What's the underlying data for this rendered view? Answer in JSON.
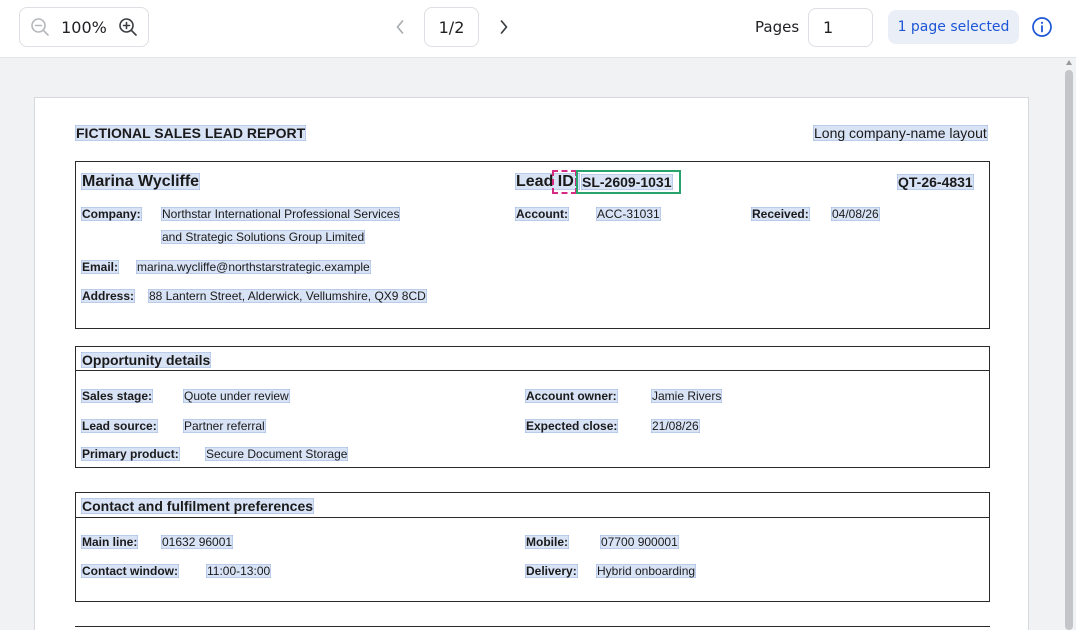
{
  "toolbar": {
    "zoom_level": "100%",
    "zoom_out_icon": "zoom-out-icon",
    "zoom_in_icon": "zoom-in-icon",
    "page_indicator": "1/2",
    "pages_label": "Pages",
    "pages_input_value": "1",
    "selection_label": "1 page selected",
    "accent_color": "#1d56d6"
  },
  "report": {
    "title": "FICTIONAL SALES LEAD REPORT",
    "layout_note": "Long company-name layout",
    "lead": {
      "name": "Marina Wycliffe",
      "lead_id_label": "Lead ID:",
      "lead_id": "SL-2609-1031",
      "quote_id": "QT-26-4831",
      "company_label": "Company:",
      "company_line1": "Northstar International Professional Services",
      "company_line2": "and Strategic Solutions Group Limited",
      "account_label": "Account:",
      "account": "ACC-31031",
      "received_label": "Received:",
      "received": "04/08/26",
      "email_label": "Email:",
      "email": "marina.wycliffe@northstarstrategic.example",
      "address_label": "Address:",
      "address": "88 Lantern Street, Alderwick, Vellumshire, QX9 8CD"
    },
    "opportunity": {
      "heading": "Opportunity details",
      "sales_stage_label": "Sales stage:",
      "sales_stage": "Quote under review",
      "account_owner_label": "Account owner:",
      "account_owner": "Jamie Rivers",
      "lead_source_label": "Lead source:",
      "lead_source": "Partner referral",
      "expected_close_label": "Expected close:",
      "expected_close": "21/08/26",
      "primary_product_label": "Primary product:",
      "primary_product": "Secure Document Storage"
    },
    "contact": {
      "heading": "Contact and fulfilment preferences",
      "main_line_label": "Main line:",
      "main_line": "01632 96001",
      "mobile_label": "Mobile:",
      "mobile": "07700 900001",
      "contact_window_label": "Contact window:",
      "contact_window": "11:00-13:00",
      "delivery_label": "Delivery:",
      "delivery": "Hybrid onboarding"
    }
  }
}
